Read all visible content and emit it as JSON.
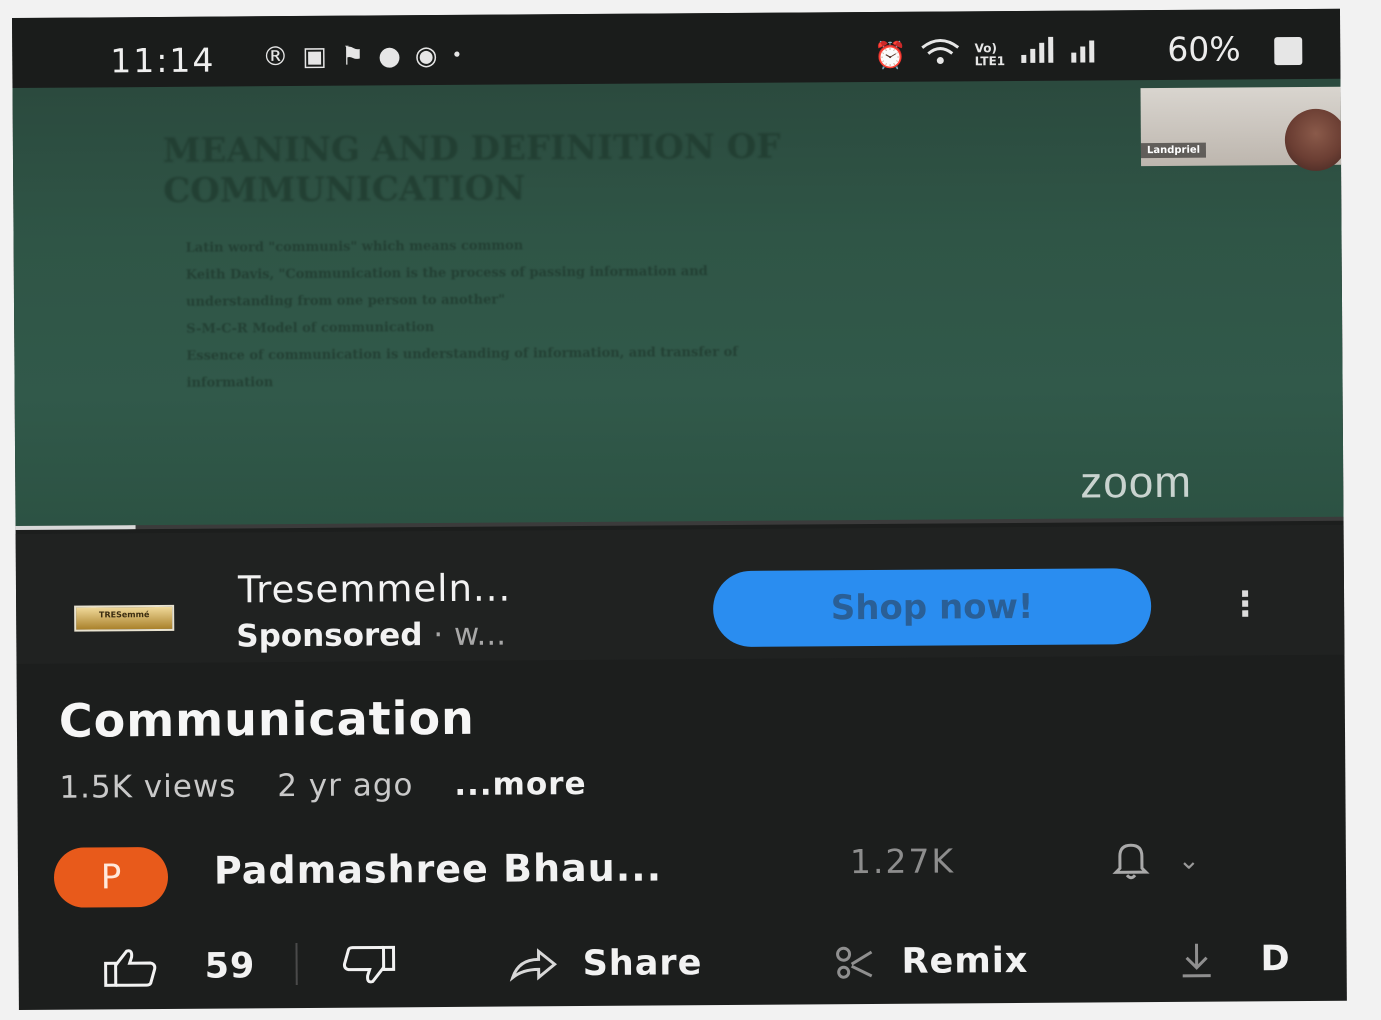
{
  "status_bar": {
    "time": "11:14",
    "battery": "60%",
    "left_icons": [
      "registered-icon",
      "cast-icon",
      "flag-icon",
      "account-icon",
      "eye-icon",
      "dot-icon"
    ],
    "right_icons": [
      "alarm-icon",
      "wifi-icon",
      "volte-icon",
      "signal-icon",
      "signal-icon-2"
    ]
  },
  "video": {
    "slide_title": "MEANING AND DEFINITION OF COMMUNICATION",
    "slide_bullets": [
      "Latin word \"communis\" which means common",
      "Keith Davis, \"Communication is the process of passing information and",
      "understanding from one person to another\"",
      "S-M-C-R Model of communication",
      "Essence of communication is understanding of information, and transfer of",
      "information"
    ],
    "participant_label": "Landpriel",
    "watermark": "zoom",
    "progress": 0.09
  },
  "ad": {
    "logo_text": "TRESemmé",
    "title": "Tresemmeln...",
    "sponsored_label": "Sponsored",
    "separator": "·",
    "sponsor_domain": "w...",
    "cta_label": "Shop now!"
  },
  "video_info": {
    "title": "Communication",
    "views": "1.5K views",
    "age": "2 yr ago",
    "more_label": "...more"
  },
  "channel": {
    "avatar_letter": "P",
    "name": "Padmashree Bhau...",
    "subscribers": "1.27K"
  },
  "actions": {
    "like_count": "59",
    "share_label": "Share",
    "remix_label": "Remix",
    "download_label": "D"
  },
  "colors": {
    "shop_button": "#2a8df0",
    "channel_avatar": "#e85a1b",
    "video_background": "#2f5546"
  }
}
